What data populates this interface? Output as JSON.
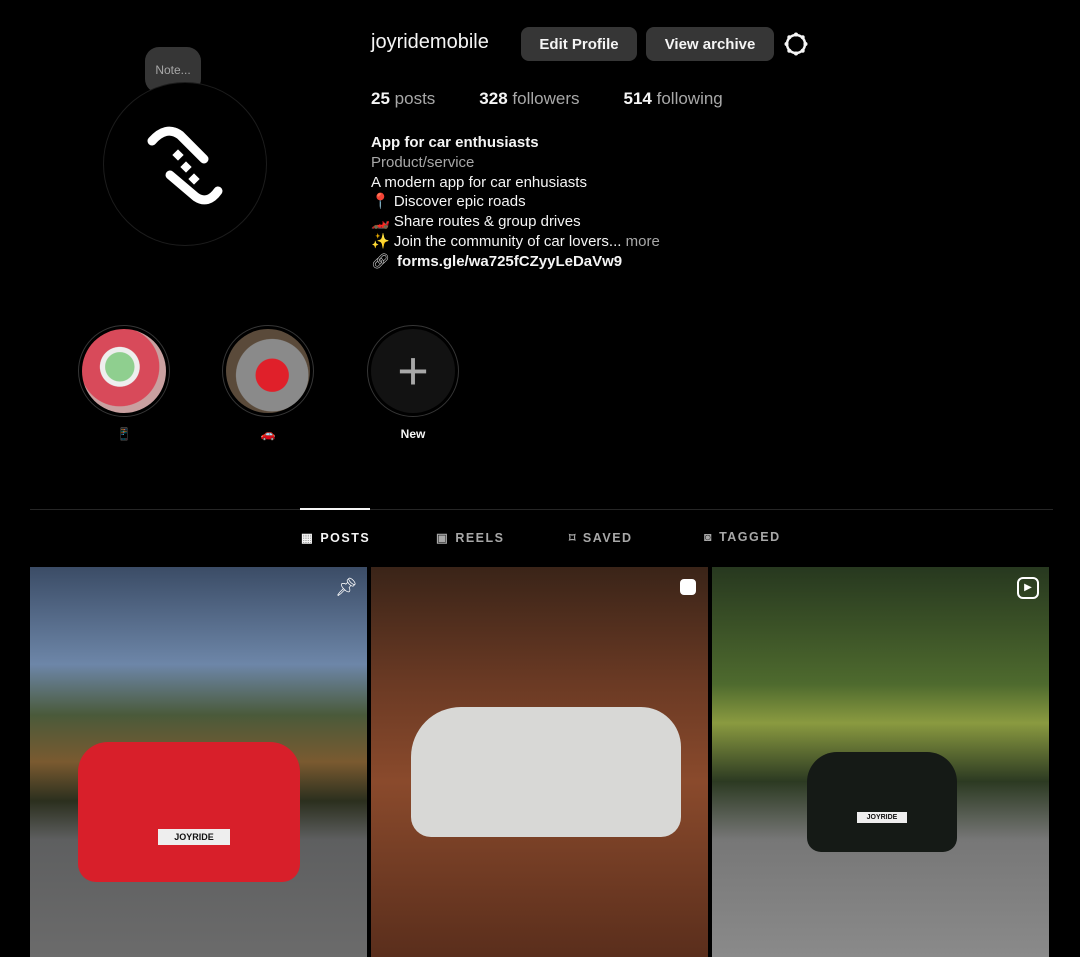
{
  "profile": {
    "username": "joyridemobile",
    "note": "Note...",
    "edit_label": "Edit Profile",
    "archive_label": "View archive",
    "stats": {
      "posts": "25",
      "posts_label": "posts",
      "followers": "328",
      "followers_label": "followers",
      "following": "514",
      "following_label": "following"
    },
    "bio": {
      "name": "App for car enthusiasts",
      "category": "Product/service",
      "lines": [
        "A modern app for car enhusiasts",
        "📍 Discover epic roads",
        "🏎️ Share routes & group drives",
        "✨ Join the community of car lovers..."
      ],
      "more": "more",
      "link": "forms.gle/wa725fCZyyLeDaVw9"
    }
  },
  "highlights": [
    {
      "label": "📱"
    },
    {
      "label": "🚗"
    },
    {
      "label": "New"
    }
  ],
  "tabs": [
    {
      "label": "POSTS",
      "icon": "grid-icon"
    },
    {
      "label": "REELS",
      "icon": "reels-icon"
    },
    {
      "label": "SAVED",
      "icon": "bookmark-icon"
    },
    {
      "label": "TAGGED",
      "icon": "tagged-icon"
    }
  ],
  "posts": [
    {
      "icon": "pin-icon",
      "plate": "JOYRIDE"
    },
    {
      "icon": "carousel-icon"
    },
    {
      "icon": "reel-icon",
      "plate": "JOYRIDE"
    }
  ]
}
